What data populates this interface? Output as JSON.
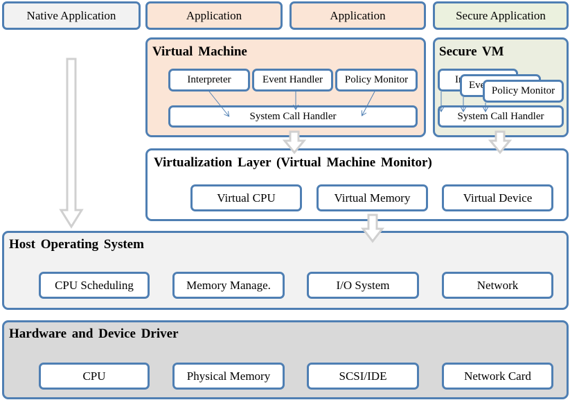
{
  "top": {
    "native": "Native Application",
    "app1": "Application",
    "app2": "Application",
    "secure_app": "Secure Application"
  },
  "vm": {
    "title": "Virtual  Machine",
    "interpreter": "Interpreter",
    "event_handler": "Event  Handler",
    "policy_monitor": "Policy  Monitor",
    "syscall": "System  Call  Handler"
  },
  "secure_vm": {
    "title": "Secure VM",
    "interpreter": "Interpreter",
    "event_handler": "Event Handler",
    "policy_monitor": "Policy  Monitor",
    "syscall": "System  Call  Handler"
  },
  "vmm": {
    "title": "Virtualization  Layer (Virtual  Machine Monitor)",
    "items": [
      "Virtual  CPU",
      "Virtual  Memory",
      "Virtual  Device"
    ]
  },
  "host": {
    "title": "Host Operating  System",
    "items": [
      "CPU Scheduling",
      "Memory Manage.",
      "I/O System",
      "Network"
    ]
  },
  "hw": {
    "title": "Hardware  and Device Driver",
    "items": [
      "CPU",
      "Physical Memory",
      "SCSI/IDE",
      "Network Card"
    ]
  },
  "colors": {
    "border": "#4f7fb3",
    "app": "#fbe5d6",
    "native": "#f2f2f2",
    "secure": "#ebf1de",
    "host": "#f2f2f2",
    "hw": "#d9d9d9"
  }
}
